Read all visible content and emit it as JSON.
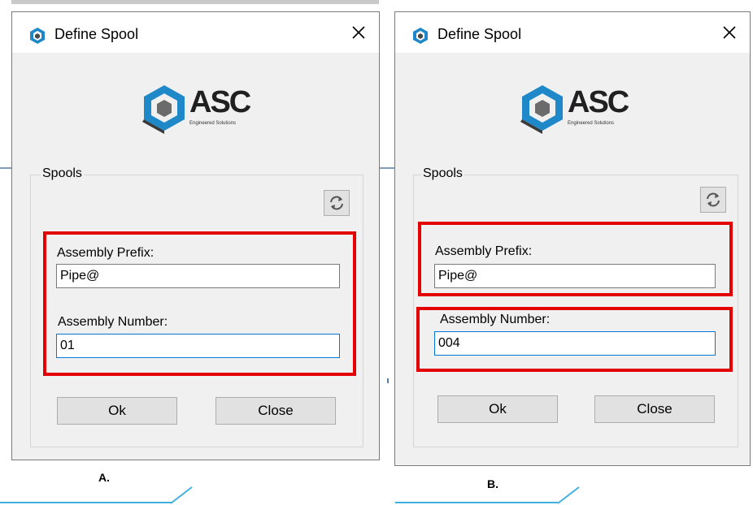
{
  "dialogs": [
    {
      "title": "Define Spool",
      "logo_text": "ASC",
      "logo_subtext": "Engineered Solutions",
      "group_label": "Spools",
      "prefix_label": "Assembly Prefix:",
      "prefix_value": "Pipe@",
      "number_label": "Assembly Number:",
      "number_value": "01",
      "ok_label": "Ok",
      "close_label": "Close",
      "caption": "A."
    },
    {
      "title": "Define Spool",
      "logo_text": "ASC",
      "logo_subtext": "Engineered Solutions",
      "group_label": "Spools",
      "prefix_label": "Assembly Prefix:",
      "prefix_value": "Pipe@",
      "number_label": "Assembly Number:",
      "number_value": "004",
      "ok_label": "Ok",
      "close_label": "Close",
      "caption": "B."
    }
  ],
  "icons": {
    "app": "asc-logo-icon",
    "close": "close-icon",
    "refresh": "refresh-icon"
  },
  "colors": {
    "highlight": "#e30000",
    "focus_border": "#0078d7",
    "logo_blue": "#1e88c8",
    "dialog_bg": "#f0f0f0"
  }
}
